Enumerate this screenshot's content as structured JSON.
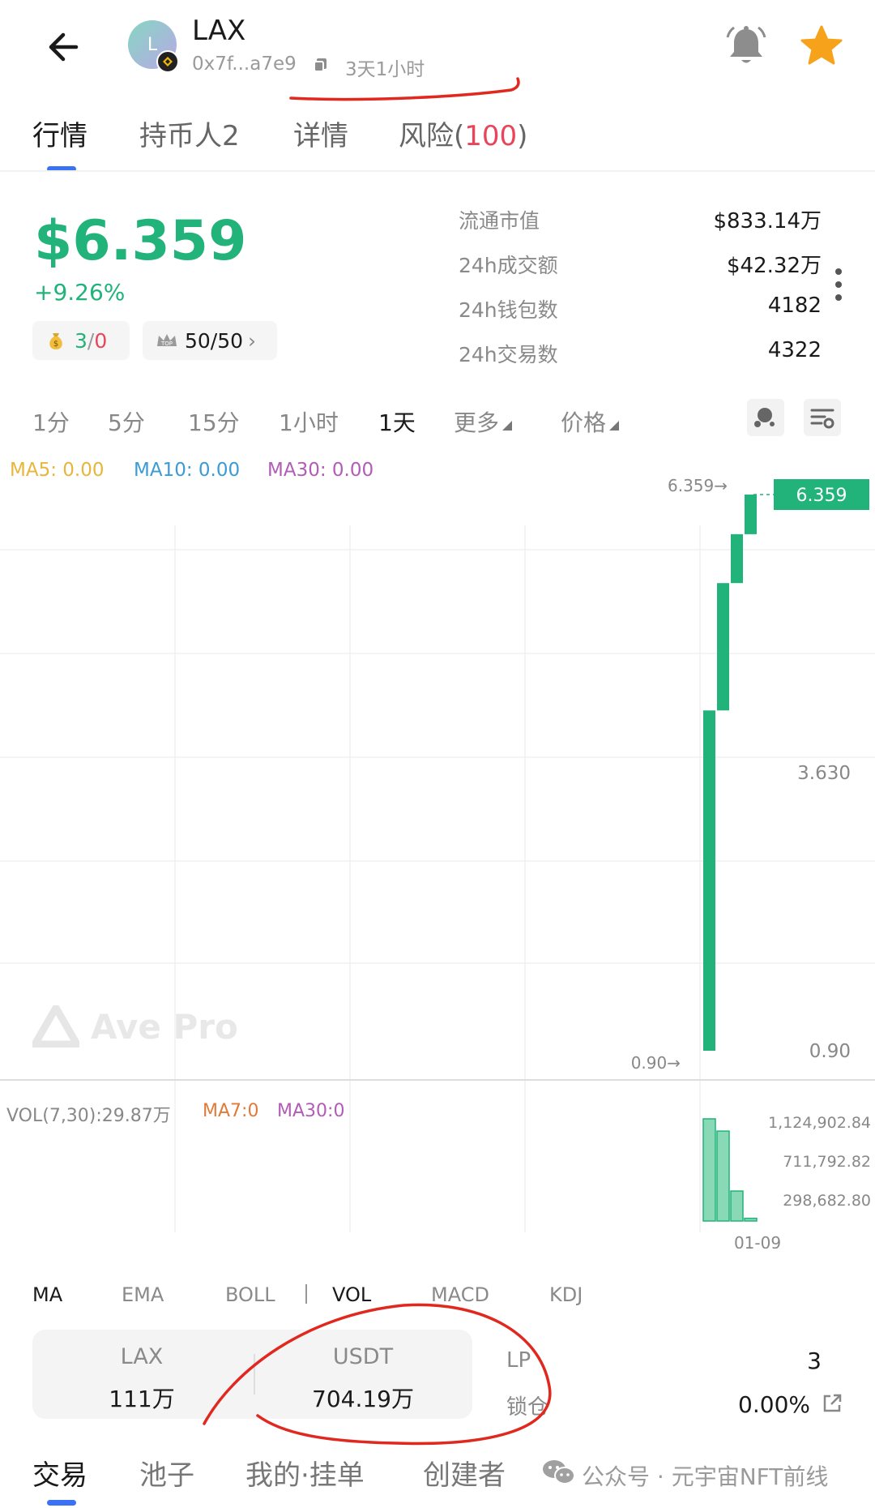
{
  "header": {
    "avatar_letter": "L",
    "symbol": "LAX",
    "address": "0x7f...a7e9",
    "age": "3天1小时"
  },
  "tabs": [
    {
      "label": "行情"
    },
    {
      "label": "持币人2"
    },
    {
      "label": "详情"
    },
    {
      "label_prefix": "风险(",
      "label_num": "100",
      "label_suffix": ")"
    }
  ],
  "price": {
    "value": "$6.359",
    "change": "+9.26%",
    "chip1_a": "3",
    "chip1_sep": "/",
    "chip1_b": "0",
    "chip2": "50/50",
    "chip2_arrow": "›"
  },
  "stats": [
    {
      "label": "流通市值",
      "value": "$833.14万"
    },
    {
      "label": "24h成交额",
      "value": "$42.32万"
    },
    {
      "label": "24h钱包数",
      "value": "4182"
    },
    {
      "label": "24h交易数",
      "value": "4322"
    }
  ],
  "intervals": [
    "1分",
    "5分",
    "15分",
    "1小时",
    "1天",
    "更多",
    "价格"
  ],
  "ma_legend": {
    "ma5": "MA5: 0.00",
    "ma10": "MA10: 0.00",
    "ma30": "MA30: 0.00"
  },
  "colors": {
    "up": "#21b37a",
    "risk": "#e8455a",
    "accent": "#3a72f6",
    "ma5": "#e7b63a",
    "ma10": "#3b9bd6",
    "ma30": "#b25cb8",
    "ma7": "#e07a3a"
  },
  "chart_data": {
    "type": "candlestick",
    "y_labels": [
      "3.630",
      "0.90"
    ],
    "current_price_label": "6.359",
    "max_marker": "6.359→",
    "min_marker": "0.90→",
    "ylim": [
      0.9,
      6.359
    ],
    "candles": [
      {
        "open": 0.9,
        "close": 4.24
      },
      {
        "open": 4.24,
        "close": 5.49
      },
      {
        "open": 5.49,
        "close": 5.97
      },
      {
        "open": 5.97,
        "close": 6.359
      }
    ],
    "volume": {
      "legend": "VOL(7,30):29.87万",
      "ma7": "MA7:0",
      "ma30": "MA30:0",
      "y_labels": [
        "1,124,902.84",
        "711,792.82",
        "298,682.80"
      ],
      "values": [
        1125000,
        990000,
        330000,
        30000
      ],
      "x_label": "01-09"
    },
    "watermark": "Ave Pro"
  },
  "indicators": [
    "MA",
    "EMA",
    "BOLL",
    "VOL",
    "MACD",
    "KDJ"
  ],
  "pool": {
    "token_a": "LAX",
    "amount_a": "111万",
    "token_b": "USDT",
    "amount_b": "704.19万",
    "lp_label": "LP",
    "lp_value": "3",
    "lock_label": "锁仓",
    "lock_value": "0.00%"
  },
  "bottom_tabs": [
    "交易",
    "池子",
    "我的·挂单",
    "创建者"
  ],
  "wechat_text": "公众号 · 元宇宙NFT前线"
}
